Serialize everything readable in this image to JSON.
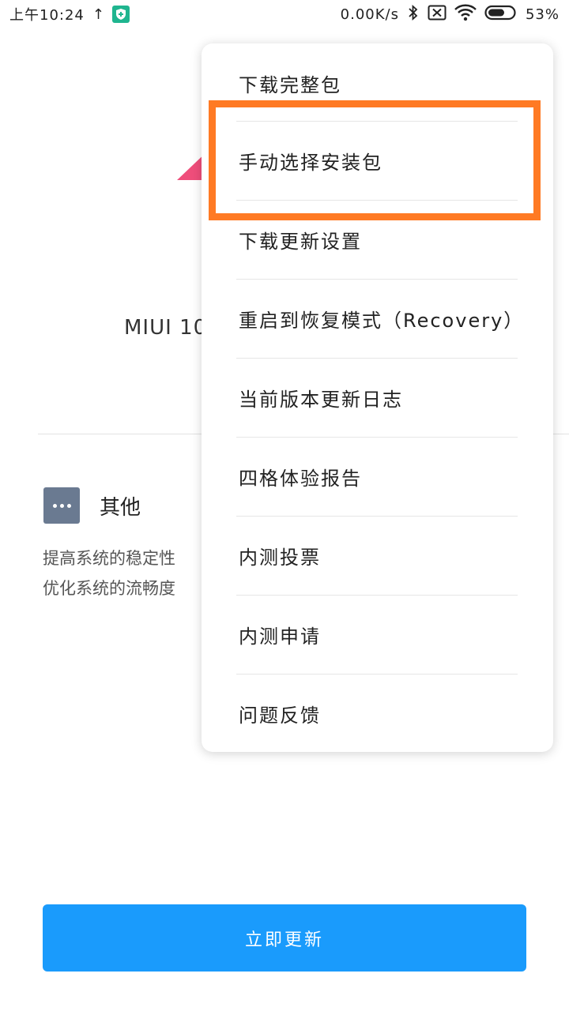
{
  "status_bar": {
    "time": "上午10:24",
    "upload_arrow": "↑",
    "net_speed": "0.00K/s",
    "battery_percent": "53%"
  },
  "background": {
    "version": "MIUI 10",
    "other_title": "其他",
    "other_desc_line1": "提高系统的稳定性",
    "other_desc_line2": "优化系统的流畅度"
  },
  "menu": {
    "items": [
      {
        "label": "下载完整包"
      },
      {
        "label": "手动选择安装包"
      },
      {
        "label": "下载更新设置"
      },
      {
        "label": "重启到恢复模式（Recovery）"
      },
      {
        "label": "当前版本更新日志"
      },
      {
        "label": "四格体验报告"
      },
      {
        "label": "内测投票"
      },
      {
        "label": "内测申请"
      },
      {
        "label": "问题反馈"
      }
    ]
  },
  "update_button": {
    "label": "立即更新"
  },
  "colors": {
    "accent_blue": "#1a9bfc",
    "highlight_orange": "#ff7a24",
    "logo_pink": "#ef4e7b",
    "shield_green": "#1fb58f"
  }
}
